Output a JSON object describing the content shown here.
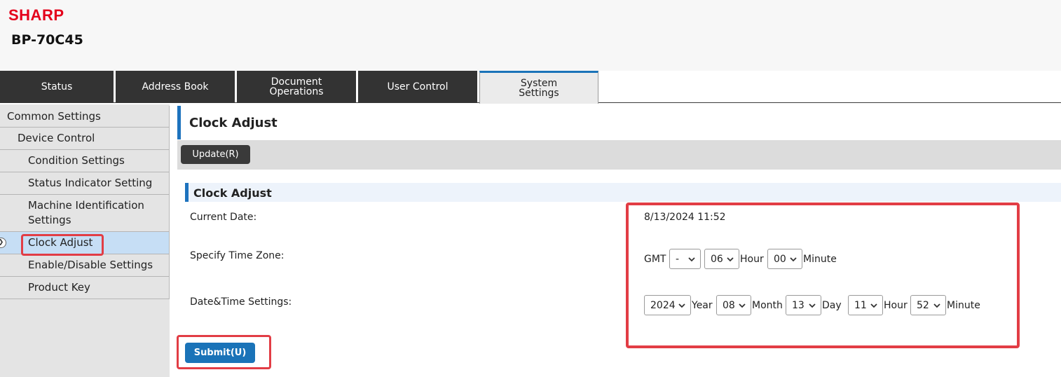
{
  "header": {
    "brand": "SHARP",
    "model": "BP-70C45"
  },
  "tabs": [
    {
      "label": "Status",
      "active": false
    },
    {
      "label": "Address Book",
      "active": false
    },
    {
      "label": "Document Operations",
      "active": false
    },
    {
      "label": "User Control",
      "active": false
    },
    {
      "label": "System Settings",
      "active": true
    }
  ],
  "sidebar": {
    "items": [
      {
        "label": "Common Settings",
        "level": 0
      },
      {
        "label": "Device Control",
        "level": 1
      },
      {
        "label": "Condition Settings",
        "level": 2
      },
      {
        "label": "Status Indicator Setting",
        "level": 2
      },
      {
        "label": "Machine Identification Settings",
        "level": 2
      },
      {
        "label": "Clock Adjust",
        "level": 2,
        "active": true
      },
      {
        "label": "Enable/Disable Settings",
        "level": 2
      },
      {
        "label": "Product Key",
        "level": 2
      }
    ]
  },
  "main": {
    "page_title": "Clock Adjust",
    "update_button": "Update(R)",
    "section_title": "Clock Adjust",
    "current_date_label": "Current Date:",
    "current_date_value": "8/13/2024 11:52",
    "timezone_label": "Specify Time Zone:",
    "timezone": {
      "prefix": "GMT",
      "sign": "-",
      "hour": "06",
      "hour_unit": "Hour",
      "minute": "00",
      "minute_unit": "Minute"
    },
    "datetime_label": "Date&Time Settings:",
    "datetime": {
      "year": "2024",
      "year_unit": "Year",
      "month": "08",
      "month_unit": "Month",
      "day": "13",
      "day_unit": "Day",
      "hour": "11",
      "hour_unit": "Hour",
      "minute": "52",
      "minute_unit": "Minute"
    },
    "submit_button": "Submit(U)"
  },
  "colors": {
    "brand_red": "#e4001b",
    "accent_blue": "#1e73be",
    "highlight_red": "#e23d45",
    "tab_dark": "#333333",
    "sidebar_active": "#c6def5"
  }
}
